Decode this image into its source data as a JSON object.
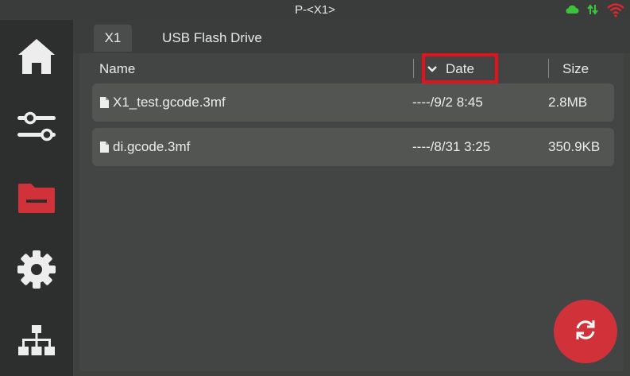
{
  "status": {
    "title": "P-<X1>",
    "icons": [
      "cloud-icon",
      "transfer-icon",
      "wifi-icon"
    ],
    "colors": {
      "cloud": "#3cc23c",
      "transfer": "#3cc23c",
      "wifi": "#e0262b"
    }
  },
  "sidebar": {
    "items": [
      {
        "icon": "home-icon",
        "active": false
      },
      {
        "icon": "sliders-icon",
        "active": false
      },
      {
        "icon": "folder-icon",
        "active": true
      },
      {
        "icon": "gear-icon",
        "active": false
      },
      {
        "icon": "network-icon",
        "active": false
      }
    ],
    "accent": "#d1323a"
  },
  "tabs": [
    {
      "label": "X1",
      "active": true
    },
    {
      "label": "USB Flash Drive",
      "active": false
    }
  ],
  "table": {
    "columns": {
      "name": "Name",
      "date": "Date",
      "size": "Size"
    },
    "sort": {
      "column": "date",
      "direction": "descending",
      "indicator": "chevron-down-icon"
    },
    "rows": [
      {
        "name": "X1_test.gcode.3mf",
        "date": "----/9/2 8:45",
        "size": "2.8MB"
      },
      {
        "name": "di.gcode.3mf",
        "date": "----/8/31 3:25",
        "size": "350.9KB"
      }
    ]
  },
  "refresh": {
    "icon": "refresh-icon"
  }
}
